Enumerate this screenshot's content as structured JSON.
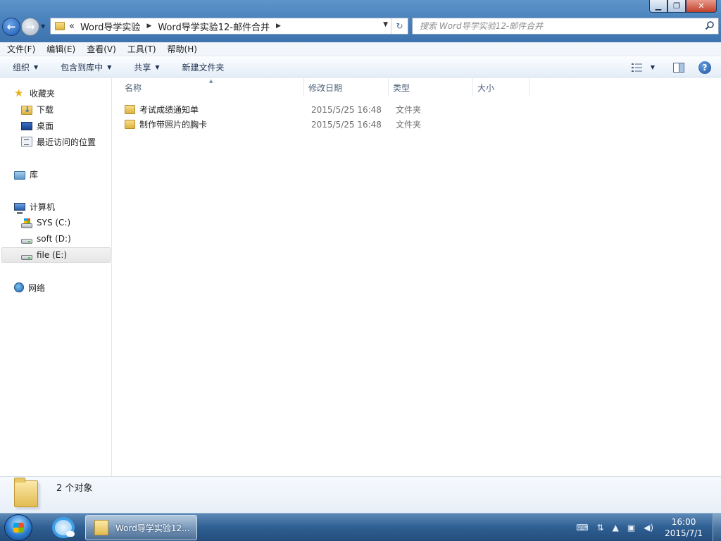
{
  "window": {
    "minimize_glyph": "▁",
    "maximize_glyph": "❐",
    "close_glyph": "✕"
  },
  "nav": {
    "back_glyph": "←",
    "forward_glyph": "→"
  },
  "address": {
    "overflow": "«",
    "crumbs": [
      "Word导学实验",
      "Word导学实验12-邮件合并"
    ]
  },
  "search": {
    "placeholder": "搜索 Word导学实验12-邮件合并"
  },
  "menu": [
    "文件(F)",
    "编辑(E)",
    "查看(V)",
    "工具(T)",
    "帮助(H)"
  ],
  "toolbar": {
    "organize": "组织",
    "include_in_library": "包含到库中",
    "share": "共享",
    "new_folder": "新建文件夹",
    "help_glyph": "?"
  },
  "sidebar": {
    "favorites": "收藏夹",
    "downloads": "下载",
    "desktop": "桌面",
    "recent": "最近访问的位置",
    "libraries": "库",
    "computer": "计算机",
    "drive_c": "SYS (C:)",
    "drive_d": "soft (D:)",
    "drive_e": "file (E:)",
    "network": "网络"
  },
  "columns": {
    "name": "名称",
    "modified": "修改日期",
    "type": "类型",
    "size": "大小"
  },
  "files": [
    {
      "name": "考试成绩通知单",
      "modified": "2015/5/25 16:48",
      "type": "文件夹"
    },
    {
      "name": "制作带照片的胸卡",
      "modified": "2015/5/25 16:48",
      "type": "文件夹"
    }
  ],
  "details": {
    "object_count": "2 个对象"
  },
  "taskbar": {
    "task_label": "Word导学实验12...",
    "time": "16:00",
    "date": "2015/7/1"
  }
}
